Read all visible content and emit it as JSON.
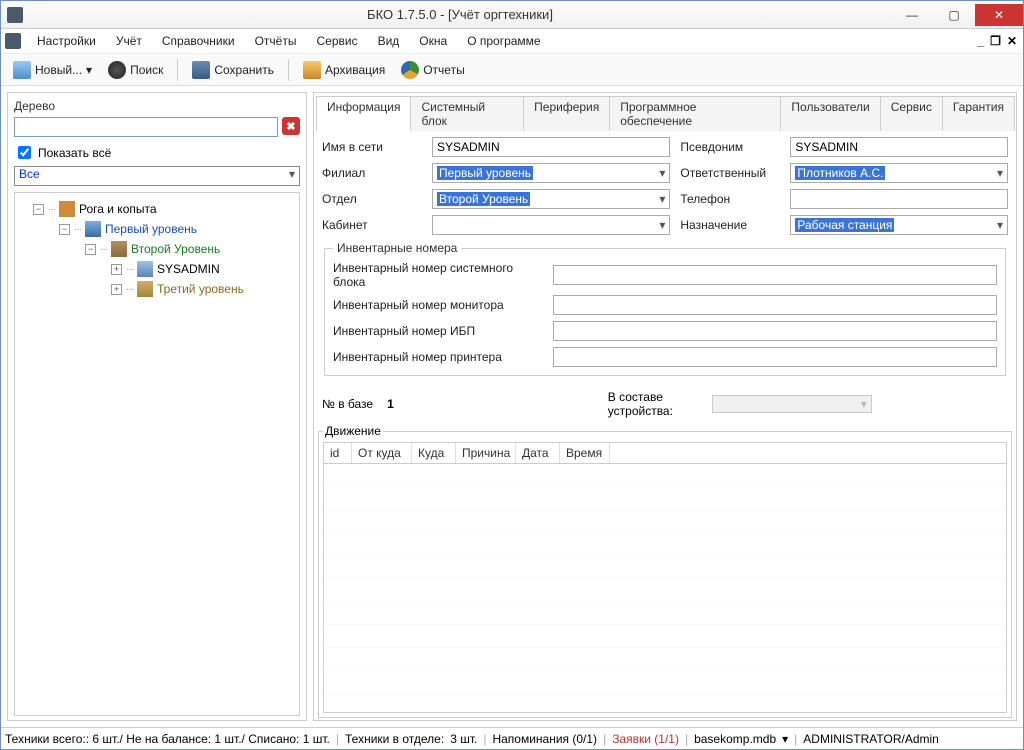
{
  "window": {
    "title": "БКО 1.7.5.0 - [Учёт оргтехники]"
  },
  "menu": [
    "Настройки",
    "Учёт",
    "Справочники",
    "Отчёты",
    "Сервис",
    "Вид",
    "Окна",
    "О программе"
  ],
  "toolbar": {
    "new": "Новый...",
    "search": "Поиск",
    "save": "Сохранить",
    "archive": "Архивация",
    "reports": "Отчеты"
  },
  "tree": {
    "title": "Дерево",
    "show_all": "Показать всё",
    "filter": "Все",
    "root": "Рога и копыта",
    "l1": "Первый уровень",
    "l2": "Второй Уровень",
    "pc": "SYSADMIN",
    "l3": "Третий уровень"
  },
  "tabs": [
    "Информация",
    "Системный блок",
    "Периферия",
    "Программное обеспечение",
    "Пользователи",
    "Сервис",
    "Гарантия"
  ],
  "form": {
    "name_lbl": "Имя в сети",
    "name_val": "SYSADMIN",
    "alias_lbl": "Псевдоним",
    "alias_val": "SYSADMIN",
    "branch_lbl": "Филиал",
    "branch_val": "Первый уровень",
    "resp_lbl": "Ответственный",
    "resp_val": "Плотников А.С.",
    "dept_lbl": "Отдел",
    "dept_val": "Второй Уровень",
    "phone_lbl": "Телефон",
    "phone_val": "",
    "office_lbl": "Кабинет",
    "office_val": "",
    "purpose_lbl": "Назначение",
    "purpose_val": "Рабочая станция"
  },
  "inv": {
    "legend": "Инвентарные номера",
    "sys": "Инвентарный номер системного блока",
    "mon": "Инвентарный номер монитора",
    "ups": "Инвентарный номер ИБП",
    "prn": "Инвентарный номер принтера"
  },
  "footer": {
    "db_no_lbl": "№ в базе",
    "db_no_val": "1",
    "compose_lbl": "В составе устройства:"
  },
  "movement": {
    "legend": "Движение",
    "cols": [
      "id",
      "От куда",
      "Куда",
      "Причина",
      "Дата",
      "Время"
    ]
  },
  "status": {
    "total": "Техники всего:: 6 шт./ Не на балансе: 1 шт./ Списано: 1 шт.",
    "dept": "Техники в отделе:",
    "dept_cnt": "3 шт.",
    "remind": "Напоминания (0/1)",
    "requests": "Заявки (1/1)",
    "db": "basekomp.mdb",
    "user": "ADMINISTRATOR/Admin"
  }
}
